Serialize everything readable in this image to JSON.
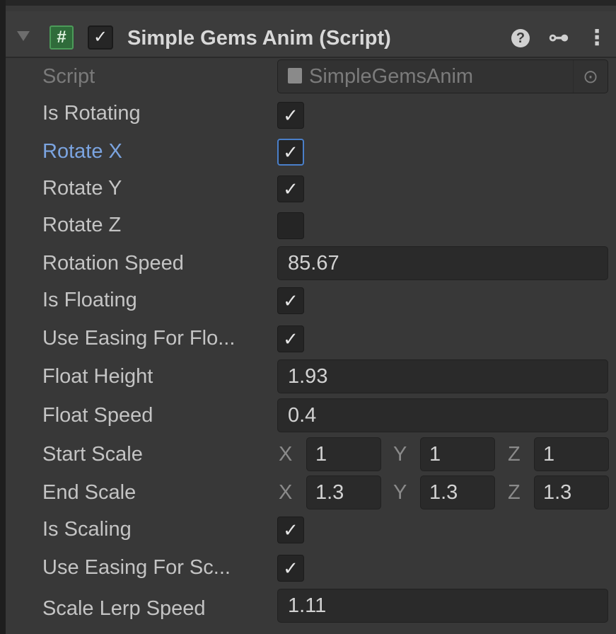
{
  "component": {
    "title": "Simple Gems Anim (Script)",
    "enabled_glyph": "✓",
    "script_glyph": "#"
  },
  "header_icons": {
    "help": "help-icon",
    "presets": "presets-icon",
    "menu": "kebab-menu-icon"
  },
  "fields": {
    "script": {
      "label": "Script",
      "value": "SimpleGemsAnim"
    },
    "is_rotating": {
      "label": "Is Rotating",
      "checked": true,
      "glyph": "✓"
    },
    "rotate_x": {
      "label": "Rotate X",
      "checked": true,
      "glyph": "✓"
    },
    "rotate_y": {
      "label": "Rotate Y",
      "checked": true,
      "glyph": "✓"
    },
    "rotate_z": {
      "label": "Rotate Z",
      "checked": false,
      "glyph": ""
    },
    "rotation_speed": {
      "label": "Rotation Speed",
      "value": "85.67"
    },
    "is_floating": {
      "label": "Is Floating",
      "checked": true,
      "glyph": "✓"
    },
    "use_easing_float": {
      "label": "Use Easing For Flo...",
      "checked": true,
      "glyph": "✓"
    },
    "float_height": {
      "label": "Float Height",
      "value": "1.93"
    },
    "float_speed": {
      "label": "Float Speed",
      "value": "0.4"
    },
    "start_scale": {
      "label": "Start Scale",
      "x_label": "X",
      "y_label": "Y",
      "z_label": "Z",
      "x": "1",
      "y": "1",
      "z": "1"
    },
    "end_scale": {
      "label": "End Scale",
      "x_label": "X",
      "y_label": "Y",
      "z_label": "Z",
      "x": "1.3",
      "y": "1.3",
      "z": "1.3"
    },
    "is_scaling": {
      "label": "Is Scaling",
      "checked": true,
      "glyph": "✓"
    },
    "use_easing_scale": {
      "label": "Use Easing For Sc...",
      "checked": true,
      "glyph": "✓"
    },
    "scale_lerp_speed": {
      "label": "Scale Lerp Speed",
      "value": "1.11"
    }
  },
  "colors": {
    "panel_bg": "#383838",
    "header_bg": "#3c3c3c",
    "focus_label": "#7ba4e0",
    "focus_border": "#4a7fc9"
  }
}
